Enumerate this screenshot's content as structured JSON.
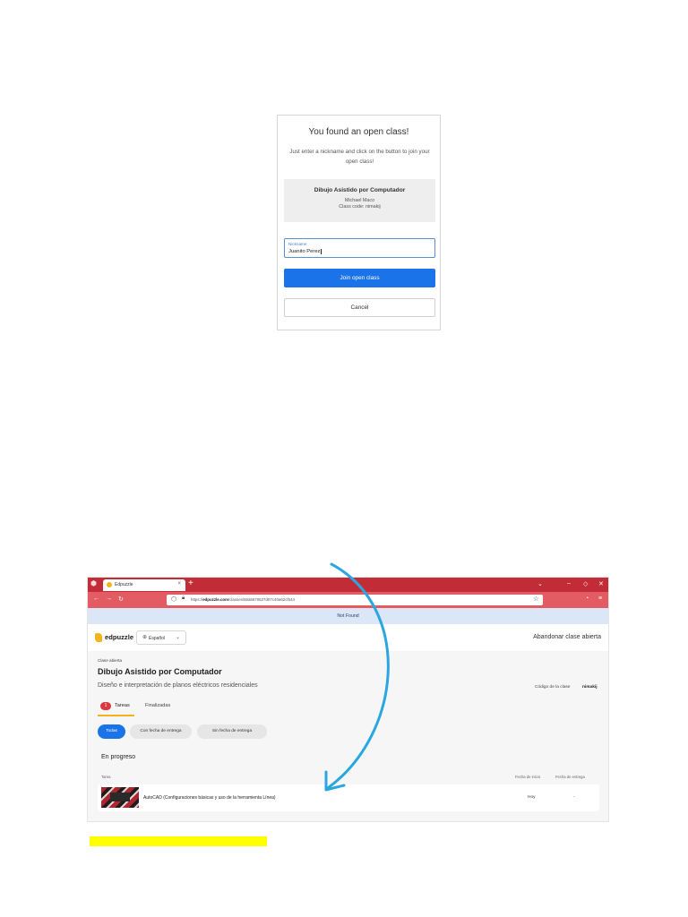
{
  "dialog": {
    "title": "You found an open class!",
    "subtitle": "Just enter a nickname and click on the button to join your open class!",
    "class_name": "Dibujo Asistido por Computador",
    "teacher": "Michael Maco",
    "class_code_line": "Class code: nimakij",
    "nickname_label": "Nickname",
    "nickname_value": "Juanito Perez",
    "join_label": "Join open class",
    "cancel_label": "Cancel"
  },
  "browser": {
    "tab_title": "Edpuzzle",
    "tab_close": "×",
    "new_tab": "+",
    "url_prefix": "https://",
    "url_domain": "edpuzzle.com",
    "url_path": "/classes/65a5670627d07c40a62cf544",
    "banner": "Not Found"
  },
  "site": {
    "logo_text": "edpuzzle",
    "language": "Español",
    "leave_button": "Abandonar clase abierta",
    "eyebrow": "Clase abierta",
    "class_title": "Dibujo Asistido por Computador",
    "class_description": "Diseño e interpretación de planos eléctricos residenciales",
    "code_label": "Código de la clase",
    "code_value": "nimakij",
    "tabs": [
      {
        "label": "Tareas",
        "count": "1"
      },
      {
        "label": "Finalizadas"
      }
    ],
    "filters": [
      "Todas",
      "Con fecha de entrega",
      "Sin fecha de entrega"
    ],
    "section_title": "En progreso",
    "columns": {
      "task": "Tarea",
      "start": "Fecha de inicio",
      "due": "Fecha de entrega"
    },
    "tasks": [
      {
        "title": "AutoCAD (Configuraciones básicas y uso de la herramienta Línea)",
        "start": "Hoy",
        "due": "-"
      }
    ]
  },
  "annotations": {
    "arrow_color": "#2aa6e0",
    "highlight_color": "#ffff00"
  }
}
